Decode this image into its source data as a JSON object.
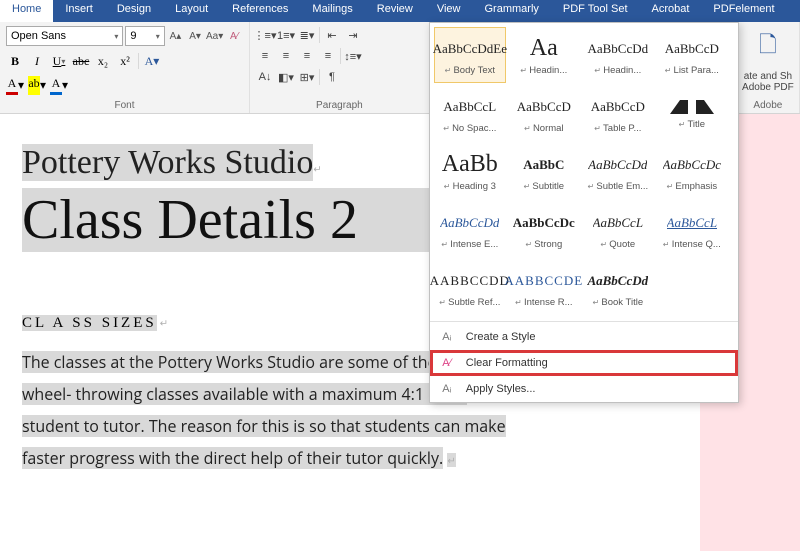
{
  "tabs": [
    "Home",
    "Insert",
    "Design",
    "Layout",
    "References",
    "Mailings",
    "Review",
    "View",
    "Grammarly",
    "PDF Tool Set",
    "Acrobat",
    "PDFelement"
  ],
  "font": {
    "name": "Open Sans",
    "size": "9"
  },
  "groups": {
    "font": "Font",
    "paragraph": "Paragraph",
    "adobe": "Adobe"
  },
  "adobe": {
    "line1": "ate and Sh",
    "line2": "Adobe PDF"
  },
  "styles_row1": [
    {
      "preview": "AaBbCcDdEe",
      "label": "Body Text",
      "sel": true
    },
    {
      "preview": "Aa",
      "label": "Headin...",
      "cls": "big"
    },
    {
      "preview": "AaBbCcDd",
      "label": "Headin...",
      "cls": ""
    },
    {
      "preview": "AaBbCcD",
      "label": "List Para...",
      "cls": ""
    }
  ],
  "styles_more": [
    {
      "preview": "AaBbCcL",
      "label": "No Spac..."
    },
    {
      "preview": "AaBbCcD",
      "label": "Normal"
    },
    {
      "preview": "AaBbCcD",
      "label": "Table P..."
    },
    {
      "preview": "shape",
      "label": "Title",
      "cls": "shape"
    },
    {
      "preview": "AaBb",
      "label": "Heading 3",
      "cls": "big"
    },
    {
      "preview": "AaBbC",
      "label": "Subtitle",
      "cls": "bold"
    },
    {
      "preview": "AaBbCcDd",
      "label": "Subtle Em...",
      "cls": "italic"
    },
    {
      "preview": "AaBbCcDc",
      "label": "Emphasis",
      "cls": "italic"
    },
    {
      "preview": "AaBbCcDd",
      "label": "Intense E...",
      "cls": "italic blue"
    },
    {
      "preview": "AaBbCcDc",
      "label": "Strong",
      "cls": "bold"
    },
    {
      "preview": "AaBbCcL",
      "label": "Quote",
      "cls": "italic"
    },
    {
      "preview": "AaBbCcL",
      "label": "Intense Q...",
      "cls": "italic blue under"
    },
    {
      "preview": "AABBCCDD",
      "label": "Subtle Ref...",
      "cls": "sc"
    },
    {
      "preview": "AABBCCDE",
      "label": "Intense R...",
      "cls": "sc blue"
    },
    {
      "preview": "AaBbCcDd",
      "label": "Book Title",
      "cls": "bold italic"
    }
  ],
  "style_menu": {
    "create": "Create a Style",
    "clear": "Clear Formatting",
    "apply": "Apply Styles..."
  },
  "doc": {
    "title": "Pottery Works Studio",
    "heading": "Class Details 2",
    "sub": "CL A SS SIZES",
    "body1": "The classes at the Pottery Works Studio are some of the smallest",
    "body2": "wheel- throwing classes available with a maximum 4:1 ratio,",
    "body3": "student to tutor. The reason for this is so that students can make",
    "body4": "faster progress with the direct help of their tutor quickly."
  }
}
